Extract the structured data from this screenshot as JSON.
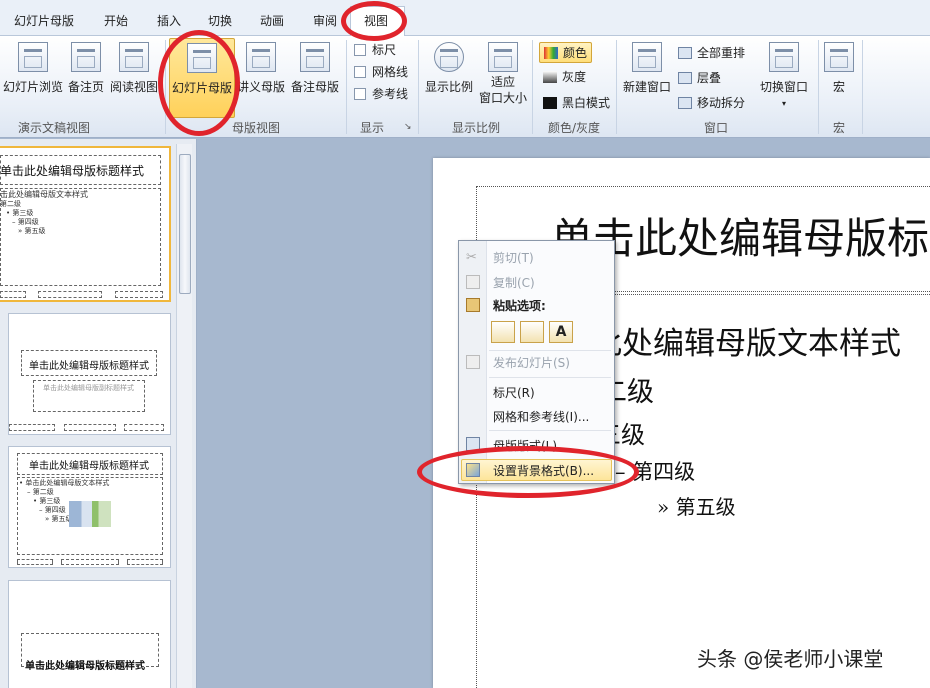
{
  "tabs": {
    "items": [
      "幻灯片母版",
      "开始",
      "插入",
      "切换",
      "动画",
      "审阅",
      "视图"
    ],
    "active": "视图"
  },
  "ribbon": {
    "presentation_views": {
      "label": "演示文稿视图",
      "buttons": [
        "幻灯片浏览",
        "备注页",
        "阅读视图"
      ]
    },
    "master_views": {
      "label": "母版视图",
      "buttons": [
        "幻灯片母版",
        "讲义母版",
        "备注母版"
      ]
    },
    "show": {
      "label": "显示",
      "checkboxes": [
        "标尺",
        "网格线",
        "参考线"
      ]
    },
    "zoom": {
      "label": "显示比例",
      "buttons": [
        "显示比例",
        "适应",
        "窗口大小"
      ]
    },
    "color": {
      "label": "颜色/灰度",
      "buttons": [
        "颜色",
        "灰度",
        "黑白模式"
      ]
    },
    "window": {
      "label": "窗口",
      "new_window": "新建窗口",
      "items": [
        "全部重排",
        "层叠",
        "移动拆分"
      ],
      "switch": "切换窗口"
    },
    "macro": {
      "label": "宏",
      "button": "宏"
    }
  },
  "thumbnails": [
    {
      "title": "单击此处编辑母版标题样式",
      "lines": [
        "击此处编辑母版文本样式",
        "第二级",
        "• 第三级",
        "– 第四级",
        "» 第五级"
      ]
    },
    {
      "title": "单击此处编辑母版标题样式",
      "sub": "单击此处编辑母版副标题样式"
    },
    {
      "title": "单击此处编辑母版标题样式",
      "lines": [
        "• 单击此处编辑母版文本样式",
        "– 第二级",
        "• 第三级",
        "– 第四级",
        "» 第五级"
      ]
    },
    {
      "title": "单击此处编辑母版标题样式"
    }
  ],
  "slide": {
    "title": "单击此处编辑母版标题样式",
    "body": [
      "单击此处编辑母版文本样式",
      "第二级",
      "第三级",
      "– 第四级",
      "» 第五级"
    ]
  },
  "context_menu": {
    "cut": "剪切(T)",
    "copy": "复制(C)",
    "paste_options": "粘贴选项:",
    "publish": "发布幻灯片(S)",
    "ruler": "标尺(R)",
    "grid": "网格和参考线(I)...",
    "layout": "母版版式(L)...",
    "background": "设置背景格式(B)..."
  },
  "watermark": "头条 @侯老师小课堂",
  "colors": {
    "annotation": "#e0242c",
    "highlight": "#ffd15a"
  }
}
